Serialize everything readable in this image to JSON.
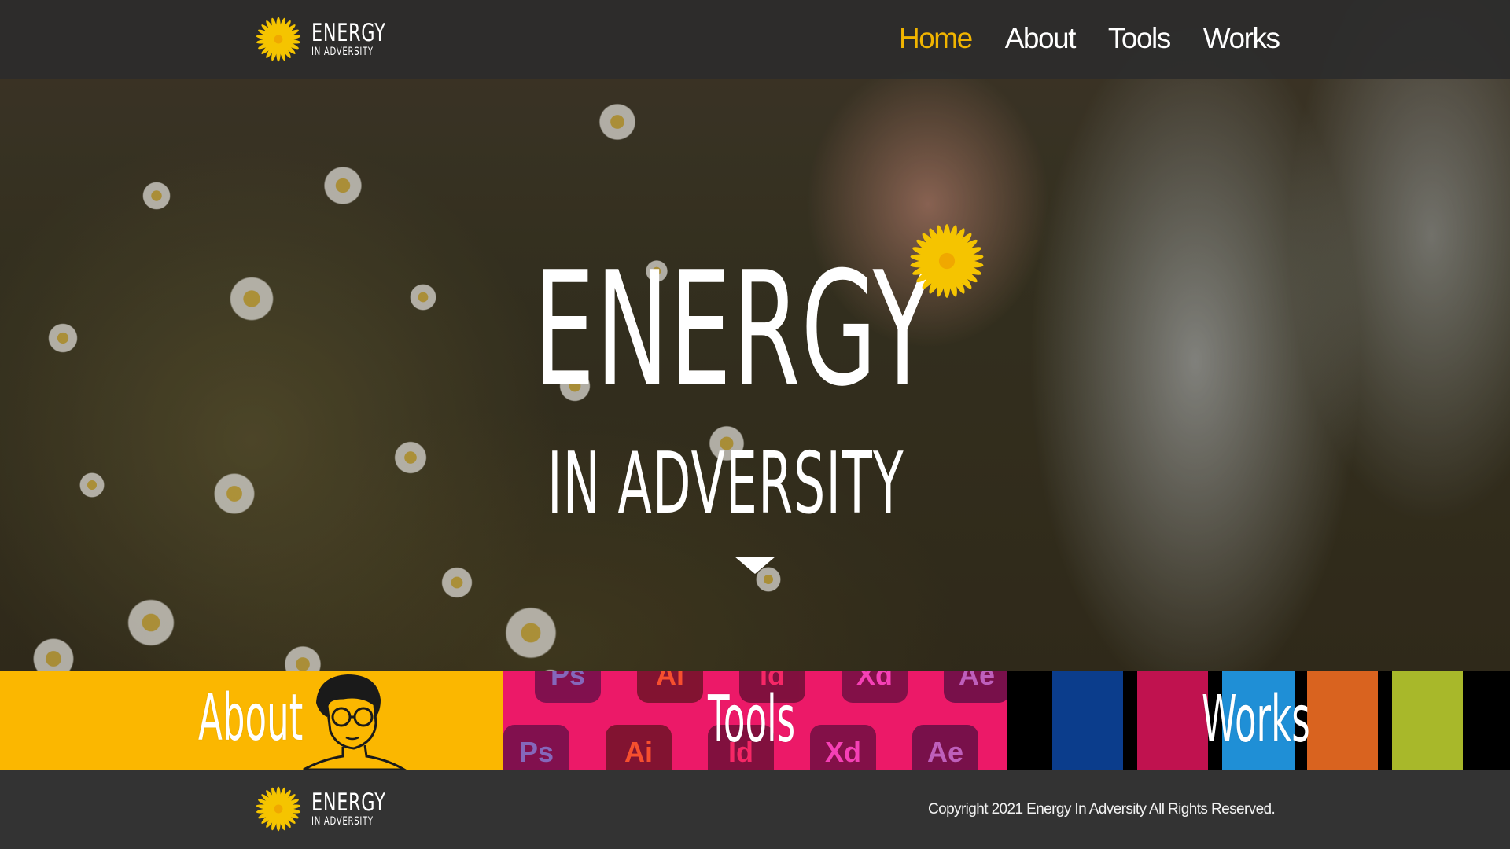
{
  "brand": {
    "line1": "ENERGY",
    "line2": "IN ADVERSITY",
    "flower_color": "#f5c400"
  },
  "nav": {
    "items": [
      "Home",
      "About",
      "Tools",
      "Works"
    ],
    "active": "Home",
    "active_color": "#f0b400"
  },
  "hero": {
    "title_line1": "ENERGY",
    "title_line2": "IN ADVERSITY",
    "scroll_icon": "chevron-down-icon"
  },
  "features": {
    "about": {
      "label": "About",
      "color": "#fbb700"
    },
    "tools": {
      "label": "Tools",
      "color": "#ec1968",
      "apps": [
        "Ps",
        "Ai",
        "Id",
        "Xd",
        "Ae",
        "Ps",
        "Ai",
        "Id",
        "Xd",
        "Ae"
      ]
    },
    "works": {
      "label": "Works",
      "colors": [
        "#0b3d8c",
        "#c0124f",
        "#1f8fd6",
        "#d9631f",
        "#a8b82a"
      ]
    }
  },
  "footer": {
    "copyright": "Copyright 2021 Energy In Adversity All Rights Reserved."
  }
}
